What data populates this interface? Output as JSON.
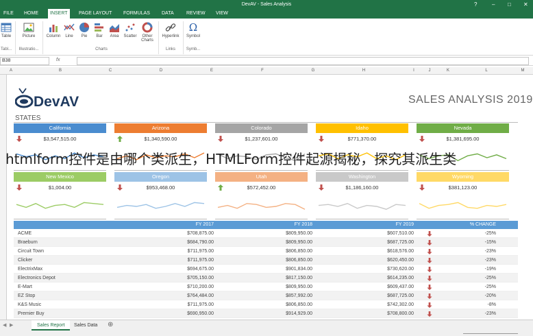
{
  "window": {
    "title": "DevAV - Sales Analysis"
  },
  "menu": [
    "FILE",
    "HOME",
    "INSERT",
    "PAGE LAYOUT",
    "FORMULAS",
    "DATA",
    "REVIEW",
    "VIEW"
  ],
  "ribbon": {
    "buttons": [
      "Table",
      "Picture",
      "Column",
      "Line",
      "Pie",
      "Bar",
      "Area",
      "Scatter",
      "Other Charts",
      "Hyperlink",
      "Symbol"
    ],
    "groups": [
      "Tabl...",
      "Illustratio...",
      "Charts",
      "Links",
      "Symb..."
    ]
  },
  "formula_bar": {
    "namebox": "B38",
    "fx": "fx"
  },
  "columns": [
    "A",
    "B",
    "C",
    "D",
    "E",
    "F",
    "G",
    "H",
    "I",
    "J",
    "K",
    "L",
    "M"
  ],
  "report": {
    "logo": "DevAV",
    "title": "SALES ANALYSIS 2019",
    "section": "STATES"
  },
  "cards": [
    {
      "name": "California",
      "value": "$3,547,515.00",
      "trend": "down",
      "color": "#4a8ccf"
    },
    {
      "name": "Arizona",
      "value": "$1,340,590.00",
      "trend": "up",
      "color": "#ed7d31"
    },
    {
      "name": "Colorado",
      "value": "$1,237,601.00",
      "trend": "down",
      "color": "#a5a5a5"
    },
    {
      "name": "Idaho",
      "value": "$771,370.00",
      "trend": "down",
      "color": "#ffc000"
    },
    {
      "name": "Nevada",
      "value": "$1,381,695.00",
      "trend": "down",
      "color": "#70ad47"
    },
    {
      "name": "New Mexico",
      "value": "$1,004.00",
      "trend": "down",
      "color": "#9ccc65"
    },
    {
      "name": "Oregon",
      "value": "$953,468.00",
      "trend": "down",
      "color": "#9dc3e6"
    },
    {
      "name": "Utah",
      "value": "$572,452.00",
      "trend": "up",
      "color": "#f4b183"
    },
    {
      "name": "Washington",
      "value": "$1,186,160.00",
      "trend": "down",
      "color": "#c9c9c9"
    },
    {
      "name": "Wyoming",
      "value": "$381,123.00",
      "trend": "down",
      "color": "#ffd966"
    }
  ],
  "overlay_text": "htmlform控件是由哪个类派生，HTMLForm控件起源揭秘，探究其派生类",
  "table": {
    "headers": [
      "",
      "FY 2017",
      "FY 2018",
      "FY 2019",
      "% CHANGE"
    ],
    "rows": [
      [
        "ACME",
        "$708,875.00",
        "$809,950.00",
        "$607,510.00",
        "-25%"
      ],
      [
        "Braeburn",
        "$684,790.00",
        "$809,950.00",
        "$687,725.00",
        "-15%"
      ],
      [
        "Circuit Town",
        "$711,975.00",
        "$806,850.00",
        "$618,576.00",
        "-23%"
      ],
      [
        "Clicker",
        "$711,975.00",
        "$806,850.00",
        "$620,450.00",
        "-23%"
      ],
      [
        "ElectrixMax",
        "$694,675.00",
        "$901,834.00",
        "$730,620.00",
        "-19%"
      ],
      [
        "Electronics Depot",
        "$705,150.00",
        "$817,150.00",
        "$614,235.00",
        "-25%"
      ],
      [
        "E-Mart",
        "$710,200.00",
        "$809,950.00",
        "$609,437.00",
        "-25%"
      ],
      [
        "EZ Stop",
        "$764,484.00",
        "$857,992.00",
        "$687,725.00",
        "-20%"
      ],
      [
        "K&S Music",
        "$711,975.00",
        "$806,850.00",
        "$742,302.00",
        "-8%"
      ],
      [
        "Premier Buy",
        "$690,950.00",
        "$914,929.00",
        "$708,800.00",
        "-23%"
      ]
    ]
  },
  "sheet_tabs": [
    "Sales Report",
    "Sales Data"
  ]
}
